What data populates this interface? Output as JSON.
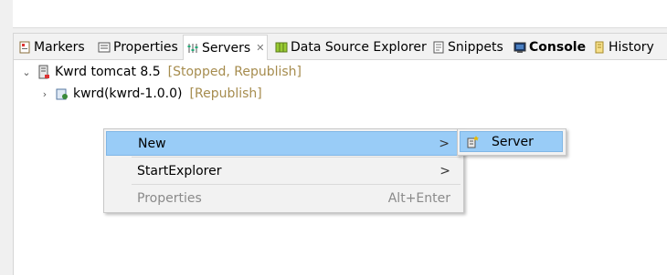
{
  "tabs": [
    {
      "label": "Markers",
      "icon": "markers-icon"
    },
    {
      "label": "Properties",
      "icon": "properties-icon"
    },
    {
      "label": "Servers",
      "icon": "servers-icon",
      "active": true
    },
    {
      "label": "Data Source Explorer",
      "icon": "data-source-icon"
    },
    {
      "label": "Snippets",
      "icon": "snippets-icon"
    },
    {
      "label": "Console",
      "icon": "console-icon",
      "bold": true
    },
    {
      "label": "History",
      "icon": "history-icon"
    }
  ],
  "tab_close_glyph": "✕",
  "tree": {
    "server": {
      "name": "Kwrd tomcat 8.5",
      "status": "[Stopped, Republish]",
      "expanded": true
    },
    "module": {
      "name": "kwrd(kwrd-1.0.0)",
      "status": "[Republish]",
      "expanded": false
    }
  },
  "context_menu": {
    "items": [
      {
        "label": "New",
        "submenu_arrow": ">",
        "highlighted": true
      },
      {
        "label": "StartExplorer",
        "submenu_arrow": ">"
      },
      {
        "label": "Properties",
        "shortcut": "Alt+Enter",
        "disabled": true
      }
    ]
  },
  "submenu": {
    "items": [
      {
        "label": "Server",
        "icon": "new-server-icon",
        "highlighted": true
      }
    ]
  },
  "colors": {
    "status_text": "#a68c4e",
    "highlight": "#99ccf7",
    "menu_bg": "#f2f2f2"
  }
}
